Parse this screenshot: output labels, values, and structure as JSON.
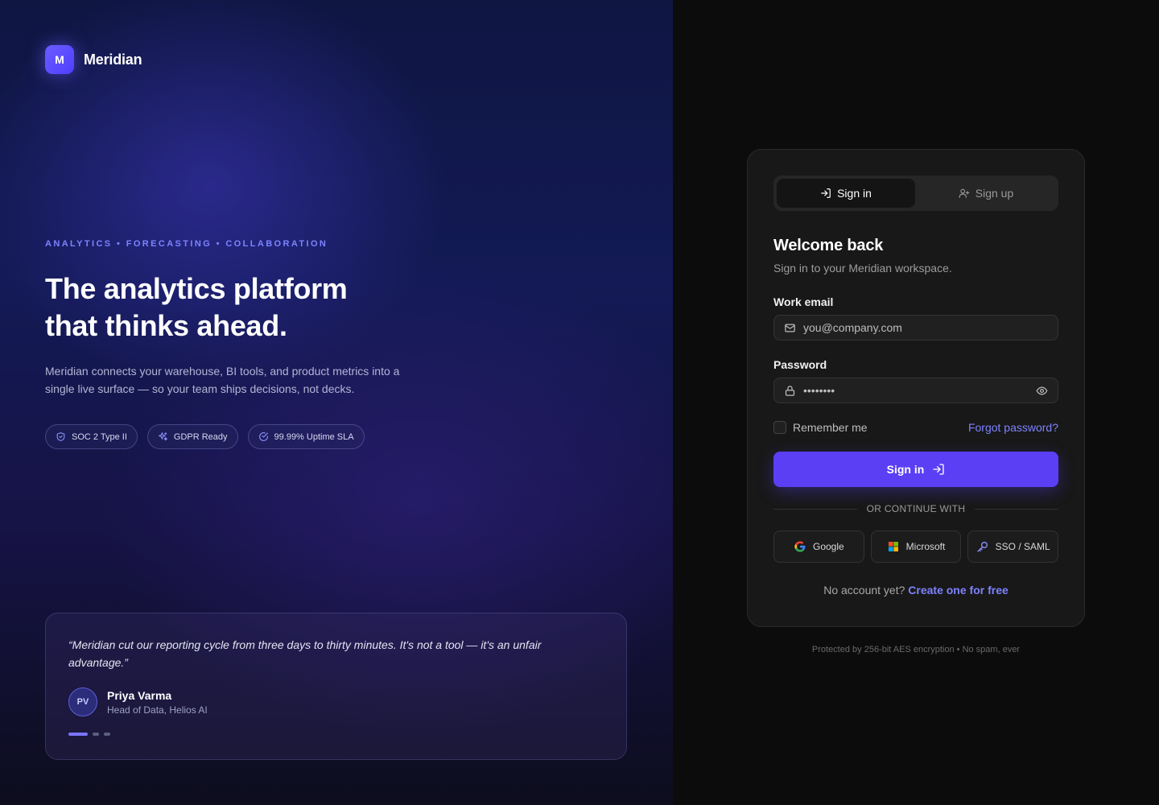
{
  "brand": {
    "mark": "M",
    "name": "Meridian"
  },
  "hero": {
    "eyebrow": "ANALYTICS • FORECASTING • COLLABORATION",
    "headline_line1": "The analytics platform",
    "headline_line2": "that thinks ahead.",
    "lede": "Meridian connects your warehouse, BI tools, and product metrics into a single live surface — so your team ships decisions, not decks."
  },
  "badges": [
    {
      "label": "SOC 2 Type II",
      "icon": "shield-icon"
    },
    {
      "label": "GDPR Ready",
      "icon": "sparkles-icon"
    },
    {
      "label": "99.99% Uptime SLA",
      "icon": "check-circle-icon"
    }
  ],
  "testimonial": {
    "quote": "“Meridian cut our reporting cycle from three days to thirty minutes. It's not a tool — it's an unfair advantage.”",
    "initials": "PV",
    "name": "Priya Varma",
    "role": "Head of Data, Helios AI",
    "slides_total": 3,
    "active_slide": 1
  },
  "auth": {
    "tabs": [
      {
        "label": "Sign in",
        "active": true,
        "icon": "log-in-icon"
      },
      {
        "label": "Sign up",
        "active": false,
        "icon": "user-plus-icon"
      }
    ],
    "title": "Welcome back",
    "subtitle": "Sign in to your Meridian workspace.",
    "email_label": "Work email",
    "email_placeholder": "you@company.com",
    "password_label": "Password",
    "password_value": "••••••••",
    "remember_label": "Remember me",
    "forgot_label": "Forgot password?",
    "submit_label": "Sign in",
    "divider_label": "OR CONTINUE WITH",
    "socials": [
      {
        "label": "Google",
        "icon": "google-icon"
      },
      {
        "label": "Microsoft",
        "icon": "microsoft-icon"
      },
      {
        "label": "SSO / SAML",
        "icon": "key-icon"
      }
    ],
    "no_account": "No account yet?",
    "create_link": "Create one for free"
  },
  "protected_note": "Protected by 256-bit AES encryption • No spam, ever",
  "colors": {
    "accent": "#5a3ff5",
    "link": "#7d83ff",
    "eyebrow": "#7c83ff"
  }
}
